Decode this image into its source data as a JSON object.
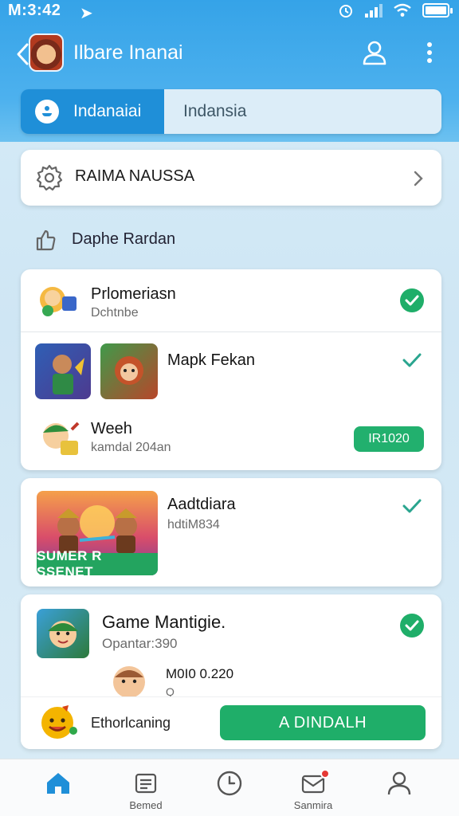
{
  "status_bar": {
    "time": "M:3:42",
    "nav_glyph": "➤"
  },
  "app_bar": {
    "title": "Ilbare Inanai",
    "back_icon": "chevron-left-icon",
    "profile_icon": "user-icon",
    "more_icon": "more-vertical-icon"
  },
  "tabs": [
    {
      "label": "Indanaiai",
      "active": true
    },
    {
      "label": "Indansia",
      "active": false
    }
  ],
  "settings_row": {
    "label": "RAIMA NAUSSA",
    "icon": "gear-icon"
  },
  "section": {
    "label": "Daphe Rardan",
    "icon": "thumb-icon"
  },
  "list_items": [
    {
      "title": "Prlomeriasn",
      "subtitle": "Dchtnbe",
      "status": "checked-filled"
    },
    {
      "title": "Mapk Fekan",
      "status": "checked-plain"
    },
    {
      "title": "Weeh",
      "subtitle": "kamdal 204an",
      "pill": "IR1020"
    }
  ],
  "card_three": {
    "title": "Aadtdiara",
    "subtitle": "hdtiM834",
    "banner_label": "SUMER R SSENET",
    "status": "checked-plain"
  },
  "card_four": {
    "title": "Game Mantigie.",
    "subtitle": "Opantar:390",
    "secondary_title": "M0I0 0.220",
    "secondary_subtitle": "Q",
    "footer_label": "Ethorlcaning",
    "cta_label": "A DINDALH",
    "status": "checked-filled"
  },
  "bottom_nav": [
    {
      "label": "",
      "icon": "home-icon",
      "active": true
    },
    {
      "label": "Bemed",
      "icon": "list-icon"
    },
    {
      "label": "",
      "icon": "clock-icon"
    },
    {
      "label": "Sanmira",
      "icon": "mail-icon",
      "badge": true
    },
    {
      "label": "",
      "icon": "user-icon"
    }
  ],
  "colors": {
    "primary": "#1f8fd8",
    "accent_green": "#1fae69",
    "header_blue": "#35a3e8"
  }
}
